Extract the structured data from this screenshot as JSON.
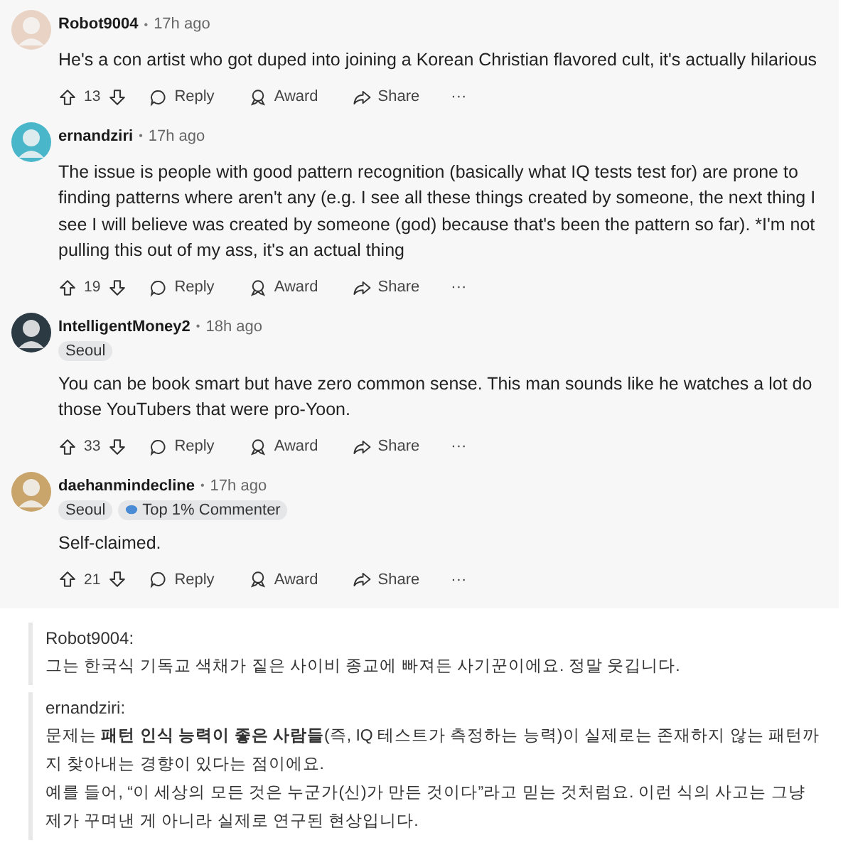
{
  "comments": [
    {
      "user": "Robot9004",
      "separator": "•",
      "time": "17h ago",
      "body": "He's a con artist who got duped into joining a Korean Christian flavored cult, it's actually hilarious",
      "votes": "13",
      "actions": [
        "Reply",
        "Award",
        "Share"
      ],
      "more": "···"
    },
    {
      "user": "ernandziri",
      "separator": "•",
      "time": "17h ago",
      "body": "The issue is people with good pattern recognition (basically what IQ tests test for) are prone to finding patterns where aren't any (e.g. I see all these things created by someone, the next thing I see I will believe was created by someone (god) because that's been the pattern so far). *I'm not pulling this out of my ass, it's an actual thing",
      "votes": "19",
      "actions": [
        "Reply",
        "Award",
        "Share"
      ],
      "more": "···"
    },
    {
      "user": "IntelligentMoney2",
      "separator": "•",
      "time": "18h ago",
      "flairs": [
        {
          "kind": "location",
          "text": "Seoul"
        }
      ],
      "body": "You can be book smart but have zero common sense. This man sounds like he watches a lot do those YouTubers that were pro-Yoon.",
      "votes": "33",
      "actions": [
        "Reply",
        "Award",
        "Share"
      ],
      "more": "···"
    },
    {
      "user": "daehanmindecline",
      "separator": "•",
      "time": "17h ago",
      "flairs": [
        {
          "kind": "location",
          "text": "Seoul"
        },
        {
          "kind": "achievement",
          "text": "Top 1% Commenter"
        }
      ],
      "body": "Self-claimed.",
      "votes": "21",
      "actions": [
        "Reply",
        "Award",
        "Share"
      ],
      "more": "···"
    }
  ],
  "translations": [
    {
      "user": "Robot9004:",
      "paragraphs": [
        "그는 한국식 기독교 색채가 짙은 사이비 종교에 빠져든 사기꾼이에요. 정말 웃깁니다."
      ]
    },
    {
      "user": "ernandziri:",
      "paragraphs": [
        "문제는 **패턴 인식 능력이 좋은 사람들**(즉, IQ 테스트가 측정하는 능력)이 실제로는 존재하지 않는 패턴까지 찾아내는 경향이 있다는 점이에요.",
        "예를 들어, “이 세상의 모든 것은 누군가(신)가 만든 것이다”라고 믿는 것처럼요. 이런 식의 사고는 그냥 제가 꾸며낸 게 아니라 실제로 연구된 현상입니다."
      ]
    }
  ]
}
